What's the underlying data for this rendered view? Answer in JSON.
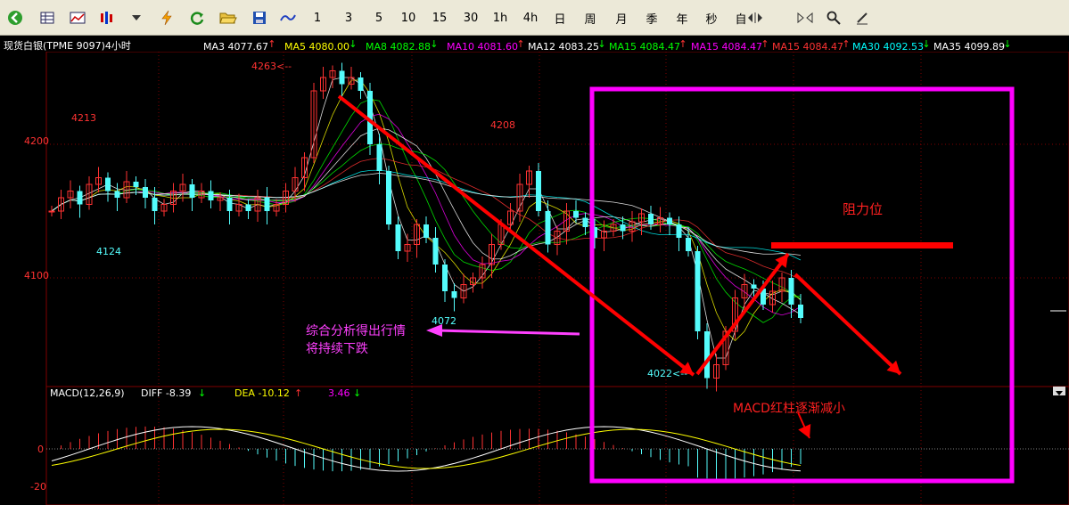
{
  "toolbar": {
    "icons": [
      "back-icon",
      "table-icon",
      "line-chart-icon",
      "multi-chart-icon",
      "dropdown-icon",
      "lightning-icon",
      "refresh-icon",
      "open-folder-icon",
      "save-icon",
      "trend-icon"
    ],
    "periods": [
      "1",
      "3",
      "5",
      "10",
      "15",
      "30",
      "1h",
      "4h",
      "日",
      "周",
      "月",
      "季",
      "年",
      "秒",
      "自"
    ],
    "tools": [
      "expand-h-icon",
      "compress-h-icon",
      "zoom-icon",
      "draw-icon"
    ]
  },
  "header": {
    "symbol": "现货白银(TPME 9097)4小时",
    "ma": [
      {
        "label": "MA3 4077.67",
        "arrow": "↑",
        "color": "#ffffff"
      },
      {
        "label": "MA5 4080.00",
        "arrow": "↓",
        "color": "#ffff00"
      },
      {
        "label": "MA8 4082.88",
        "arrow": "↓",
        "color": "#00ff00"
      },
      {
        "label": "MA10 4081.60",
        "arrow": "↑",
        "color": "#ff00ff"
      },
      {
        "label": "MA12 4083.25",
        "arrow": "↓",
        "color": "#ffffff"
      },
      {
        "label": "MA15 4084.47",
        "arrow": "↑",
        "color": "#00ff00"
      },
      {
        "label": "MA15 4084.47",
        "arrow": "↑",
        "color": "#ff00ff"
      },
      {
        "label": "MA15 4084.47",
        "arrow": "↑",
        "color": "#ff3333"
      },
      {
        "label": "MA30 4092.53",
        "arrow": "↓",
        "color": "#00ffff"
      },
      {
        "label": "MA35 4099.89",
        "arrow": "↓",
        "color": "#ffffff"
      }
    ]
  },
  "price_axis": {
    "levels": [
      "4200",
      "4100"
    ]
  },
  "price_marks": {
    "high_4263": "4263<--",
    "p4213": "4213",
    "p4208": "4208",
    "p4124": "4124",
    "p4072": "4072",
    "low_4022": "4022<--"
  },
  "annotations": {
    "resistance": "阻力位",
    "analysis_line1": "综合分析得出行情",
    "analysis_line2": "将持续下跌",
    "macd_note": "MACD红柱逐渐减小"
  },
  "macd": {
    "title": "MACD(12,26,9)",
    "diff": "DIFF  -8.39",
    "diff_arrow": "↓",
    "dea": "DEA  -10.12",
    "dea_arrow": "↑",
    "macd_val": "3.46",
    "macd_arrow": "↓",
    "axis": [
      "0",
      "-20"
    ]
  },
  "colors": {
    "up": "#ff3232",
    "down": "#54fcfc",
    "highlight_box": "#ff00ff",
    "arrow": "#ff0000",
    "grid": "#800000"
  }
}
